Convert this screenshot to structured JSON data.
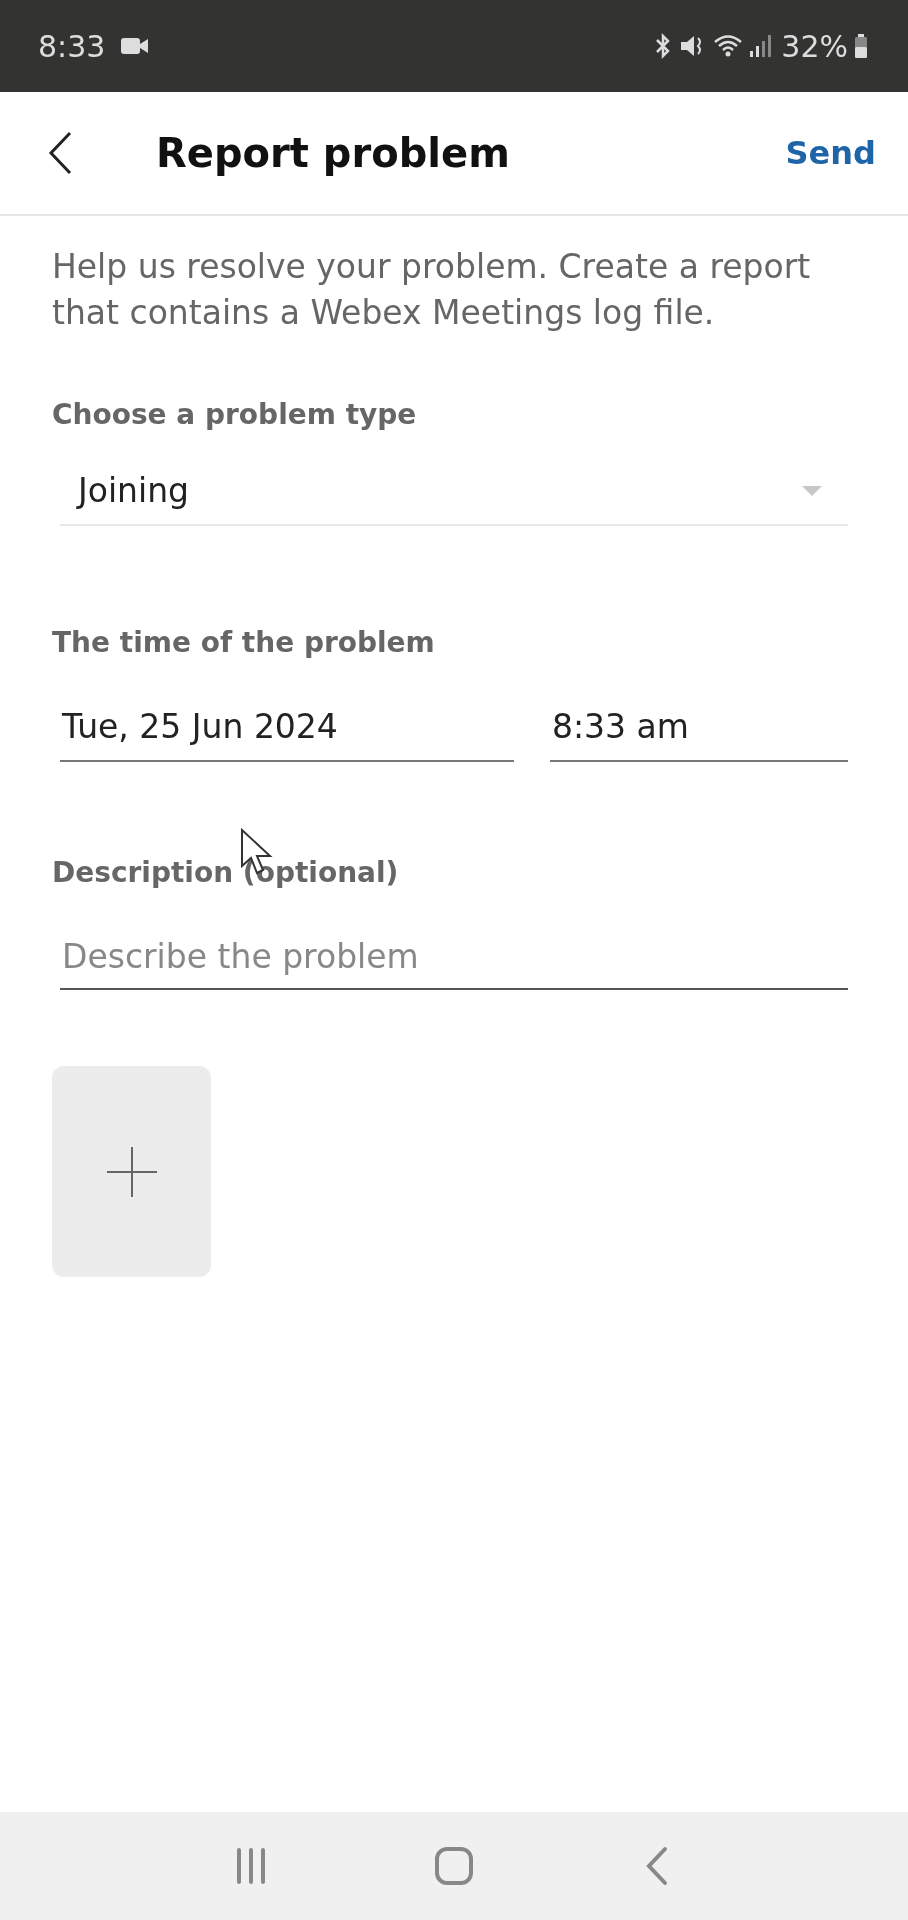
{
  "status_bar": {
    "time": "8:33",
    "battery": "32%"
  },
  "header": {
    "title": "Report problem",
    "action": "Send"
  },
  "intro": "Help us resolve your problem. Create a report that contains a Webex Meetings log file.",
  "problem_type": {
    "label": "Choose a problem type",
    "value": "Joining"
  },
  "time_of_problem": {
    "label": "The time of the problem",
    "date": "Tue, 25 Jun 2024",
    "time": "8:33 am"
  },
  "description": {
    "label": "Description (optional)",
    "placeholder": "Describe the problem"
  }
}
